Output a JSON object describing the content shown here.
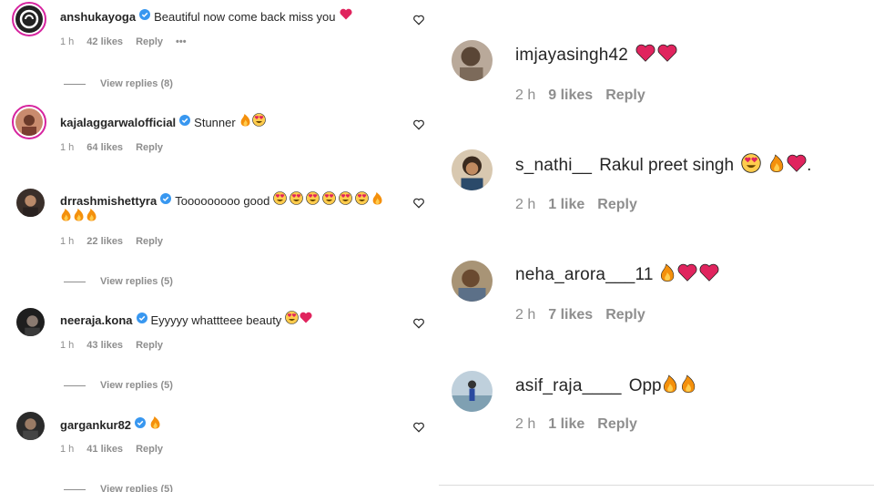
{
  "left_comments": [
    {
      "username": "anshukayoga",
      "verified": true,
      "text": "Beautiful now come back miss you",
      "emojis": [
        "red-heart"
      ],
      "time": "1 h",
      "likes": "42 likes",
      "reply": "Reply",
      "more": "•••",
      "view_replies": "View replies (8)"
    },
    {
      "username": "kajalaggarwalofficial",
      "verified": true,
      "text": "Stunner",
      "emojis": [
        "fire",
        "heart-eyes"
      ],
      "time": "1 h",
      "likes": "64 likes",
      "reply": "Reply",
      "view_replies": ""
    },
    {
      "username": "drrashmishettyra",
      "verified": true,
      "text": "Tooooooooo good",
      "emojis": [
        "heart-eyes",
        "heart-eyes",
        "heart-eyes",
        "heart-eyes",
        "heart-eyes",
        "heart-eyes",
        "fire",
        "fire",
        "fire",
        "fire"
      ],
      "time": "1 h",
      "likes": "22 likes",
      "reply": "Reply",
      "view_replies": "View replies (5)"
    },
    {
      "username": "neeraja.kona",
      "verified": true,
      "text": "Eyyyyy whattteee beauty",
      "emojis": [
        "heart-eyes",
        "red-heart"
      ],
      "time": "1 h",
      "likes": "43 likes",
      "reply": "Reply",
      "view_replies": "View replies (5)"
    },
    {
      "username": "gargankur82",
      "verified": true,
      "text": "",
      "emojis": [
        "fire"
      ],
      "time": "1 h",
      "likes": "41 likes",
      "reply": "Reply",
      "view_replies": "View replies (5)"
    }
  ],
  "right_comments": [
    {
      "username": "imjayasingh42",
      "text": "",
      "emojis": [
        "red-heart",
        "red-heart"
      ],
      "time": "2 h",
      "likes": "9 likes",
      "reply": "Reply"
    },
    {
      "username": "s_nathi__",
      "text": "Rakul preet singh",
      "emojis": [
        "heart-eyes",
        "fire",
        "red-heart"
      ],
      "suffix": ".",
      "time": "2 h",
      "likes": "1 like",
      "reply": "Reply"
    },
    {
      "username": "neha_arora___11",
      "text": "",
      "emojis": [
        "fire",
        "red-heart",
        "red-heart"
      ],
      "time": "2 h",
      "likes": "7 likes",
      "reply": "Reply"
    },
    {
      "username": "asif_raja____",
      "text": "Opp",
      "emojis": [
        "fire",
        "fire"
      ],
      "time": "2 h",
      "likes": "1 like",
      "reply": "Reply"
    }
  ],
  "colors": {
    "username": "#262626",
    "meta": "#8e8e8e",
    "verified": "#3897f0",
    "heart_red": "#e0245e",
    "fire": "#f4900c",
    "ring": "#d6249f"
  }
}
